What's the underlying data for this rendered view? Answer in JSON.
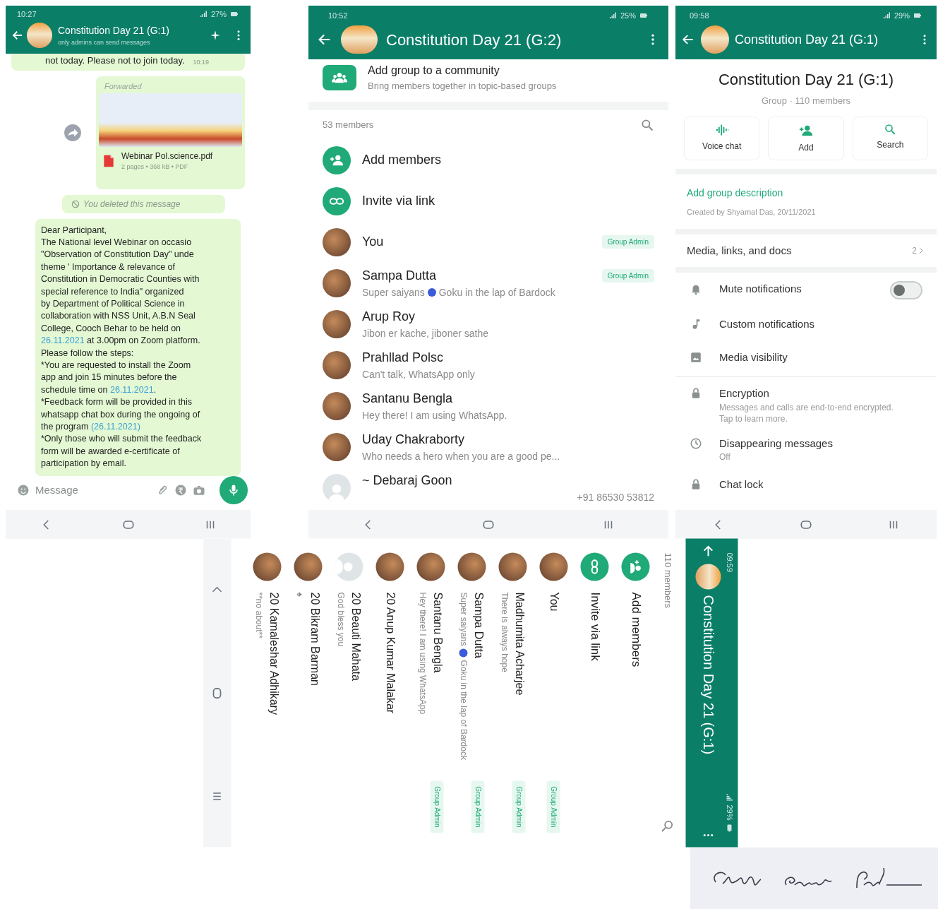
{
  "chat_screen": {
    "status_bar": {
      "time": "10:27",
      "battery": "27%"
    },
    "header": {
      "title": "Constitution Day 21 (G:1)",
      "subtitle": "only admins can send messages"
    },
    "messages": [
      {
        "kind": "text",
        "text": "not today. Please not to join today.",
        "time": "10:19"
      },
      {
        "kind": "document",
        "forwarded_label": "Forwarded",
        "file_name": "Webinar Pol.science.pdf",
        "file_info": "2 pages • 368 kB • PDF"
      },
      {
        "kind": "deleted",
        "text": "You deleted this message"
      },
      {
        "kind": "long",
        "lines": [
          [
            {
              "text": "Dear Participant,"
            }
          ],
          [
            {
              "text": "The National level Webinar on occasio"
            }
          ],
          [
            {
              "text": "\"Observation of Constitution Day\" unde"
            }
          ],
          [
            {
              "text": "theme ' Importance & relevance of"
            }
          ],
          [
            {
              "text": "Constitution in Democratic Counties with"
            }
          ],
          [
            {
              "text": "special reference to India\"  organized"
            }
          ],
          [
            {
              "text": "by Department of Political Science in"
            }
          ],
          [
            {
              "text": "collaboration with NSS Unit, A.B.N Seal"
            }
          ],
          [
            {
              "text": "College, Cooch Behar to be held on"
            }
          ],
          [
            {
              "text": "26.11.2021",
              "link": true
            },
            {
              "text": " at 3.00pm on Zoom platform."
            }
          ],
          [
            {
              "text": "Please follow the steps:"
            }
          ],
          [
            {
              "text": "*You are requested to install the Zoom"
            }
          ],
          [
            {
              "text": "app and join 15 minutes before the"
            }
          ],
          [
            {
              "text": "schedule time on "
            },
            {
              "text": "26.11.2021",
              "link": true
            },
            {
              "text": "."
            }
          ],
          [
            {
              "text": "*Feedback form will be provided in this"
            }
          ],
          [
            {
              "text": "whatsapp chat box during the ongoing of"
            }
          ],
          [
            {
              "text": "the program "
            },
            {
              "text": "(26.11.2021)",
              "link": true
            }
          ],
          [
            {
              "text": "*Only those who will submit the feedback"
            }
          ],
          [
            {
              "text": "form will be awarded e-certificate of"
            }
          ],
          [
            {
              "text": "participation by email."
            }
          ]
        ]
      }
    ],
    "composer": {
      "placeholder": "Message"
    }
  },
  "members_screen": {
    "status_bar": {
      "time": "10:52",
      "battery": "25%"
    },
    "header": {
      "title": "Constitution Day 21 (G:2)"
    },
    "community": {
      "title": "Add group to a community",
      "subtitle": "Bring members together in topic-based groups"
    },
    "count": "53 members",
    "actions": [
      {
        "kind": "add",
        "label": "Add members"
      },
      {
        "kind": "link",
        "label": "Invite via link"
      }
    ],
    "members": [
      {
        "kind": "photo",
        "name": "You",
        "badge": "Group Admin"
      },
      {
        "kind": "photo",
        "name": "Sampa Dutta",
        "badge": "Group Admin",
        "status": [
          "Super saiyans",
          "Goku in the lap of Bardock"
        ]
      },
      {
        "kind": "photo",
        "name": "Arup Roy",
        "status": [
          "Jibon er kache, jiboner sathe"
        ]
      },
      {
        "kind": "photo",
        "name": "Prahllad Polsc",
        "status": [
          "Can't talk, WhatsApp only"
        ]
      },
      {
        "kind": "photo",
        "name": "Santanu Bengla",
        "status": [
          "Hey there! I am using WhatsApp."
        ]
      },
      {
        "kind": "photo",
        "name": "Uday Chakraborty",
        "status": [
          "Who needs a hero when you are a good pe..."
        ]
      },
      {
        "kind": "default",
        "name": "~ Debaraj Goon",
        "phone": "+91 86530 53812"
      }
    ]
  },
  "info_screen": {
    "status_bar": {
      "time": "09:58",
      "battery": "29%"
    },
    "header": {
      "title": "Constitution Day 21 (G:1)"
    },
    "group_name": "Constitution Day 21 (G:1)",
    "group_meta": "Group · 110 members",
    "quick_actions": [
      {
        "kind": "voice",
        "label": "Voice chat"
      },
      {
        "kind": "add",
        "label": "Add"
      },
      {
        "kind": "search",
        "label": "Search"
      }
    ],
    "description_link": "Add group description",
    "created_by": "Created by Shyamal Das, 20/11/2021",
    "media": {
      "label": "Media, links, and docs",
      "count": "2"
    },
    "settings": [
      [
        {
          "kind": "switch",
          "label": "Mute notifications",
          "on": false
        },
        {
          "kind": "plain",
          "label": "Custom notifications"
        },
        {
          "kind": "plain",
          "label": "Media visibility"
        }
      ],
      [
        {
          "kind": "plain",
          "label": "Encryption",
          "detail": "Messages and calls are end-to-end encrypted. Tap to learn more."
        },
        {
          "kind": "plain",
          "label": "Disappearing messages",
          "detail": "Off"
        },
        {
          "kind": "plain",
          "label": "Chat lock"
        }
      ]
    ]
  },
  "rotated_members_screen": {
    "count": "110 members",
    "actions": [
      {
        "kind": "add",
        "label": "Add members"
      },
      {
        "kind": "link",
        "label": "Invite via link"
      }
    ],
    "members": [
      {
        "kind": "photo",
        "name": "You",
        "badge": "Group Admin"
      },
      {
        "kind": "photo",
        "name": "Madhumita Acharjee",
        "badge": "Group Admin",
        "status": [
          "There is always hope"
        ]
      },
      {
        "kind": "photo",
        "name": "Sampa Dutta",
        "badge": "Group Admin",
        "status": [
          "Super saiyans",
          "Goku in the lap of Bardock"
        ]
      },
      {
        "kind": "photo",
        "name": "Santanu Bengla",
        "badge": "Group Admin",
        "status": [
          "Hey there! I am using WhatsApp"
        ]
      },
      {
        "kind": "photo",
        "name": "20 Anup Kumar Malakar"
      },
      {
        "kind": "default",
        "name": "20 Beauti Mahata",
        "status": [
          "God bless you"
        ]
      },
      {
        "kind": "photo",
        "name": "20 Bikram Barman",
        "status": [
          "♠"
        ]
      },
      {
        "kind": "photo",
        "name": "20 Kamaleshar Adhikary",
        "status": [
          "**no about**"
        ]
      }
    ]
  },
  "rotated_header": {
    "time": "09:59",
    "battery": "29%",
    "title": "Constitution Day 21 (G:1)"
  }
}
